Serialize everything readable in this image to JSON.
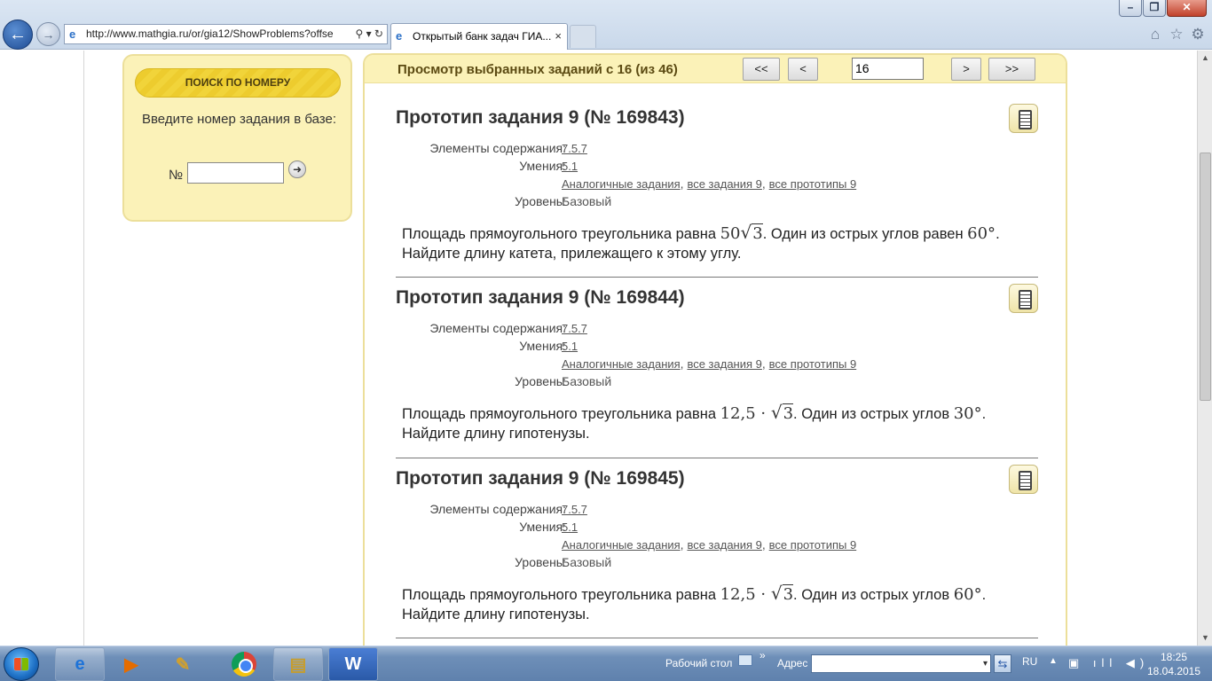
{
  "browser": {
    "address": "http://www.mathgia.ru/or/gia12/ShowProblems?offse",
    "tab_title": "Открытый банк задач ГИА...",
    "tab_close": "×",
    "back": "←",
    "forward": "→",
    "address_tools": "⚲ ▾ ↻",
    "window_min": "–",
    "window_max": "❐",
    "window_close": "✕"
  },
  "sidebar": {
    "search_title": "ПОИСК ПО НОМЕРУ",
    "prompt": "Введите номер задания в базе:",
    "num_label": "№",
    "num_value": "",
    "go_icon": "➜"
  },
  "viewer": {
    "title": "Просмотр выбранных заданий с 16 (из 46)",
    "first": "<<",
    "prev": "<",
    "page": "16",
    "next": ">",
    "last": ">>"
  },
  "problems": [
    {
      "title": "Прототип задания 9 (№ 169843)",
      "elements_label": "Элементы содержания:",
      "elements_value": "7.5.7",
      "skills_label": "Умения:",
      "skills_value": "5.1",
      "links": [
        "Аналогичные задания",
        "все задания 9",
        "все прототипы 9"
      ],
      "level_label": "Уровень:",
      "level_value": "Базовый",
      "text_before": "Площадь прямоугольного треугольника равна ",
      "math1": "50",
      "math1_sqrt": "3",
      "text_mid": ". Один из острых углов равен ",
      "math2": "60°",
      "text_after": ". Найдите длину катета, прилежащего к этому углу."
    },
    {
      "title": "Прототип задания 9 (№ 169844)",
      "elements_label": "Элементы содержания:",
      "elements_value": "7.5.7",
      "skills_label": "Умения:",
      "skills_value": "5.1",
      "links": [
        "Аналогичные задания",
        "все задания 9",
        "все прототипы 9"
      ],
      "level_label": "Уровень:",
      "level_value": "Базовый",
      "text_before": "Площадь прямоугольного треугольника равна ",
      "math1": "12,5 · ",
      "math1_sqrt": "3",
      "text_mid": ". Один из острых углов ",
      "math2": "30°",
      "text_after": ". Найдите длину гипотенузы."
    },
    {
      "title": "Прототип задания 9 (№ 169845)",
      "elements_label": "Элементы содержания:",
      "elements_value": "7.5.7",
      "skills_label": "Умения:",
      "skills_value": "5.1",
      "links": [
        "Аналогичные задания",
        "все задания 9",
        "все прототипы 9"
      ],
      "level_label": "Уровень:",
      "level_value": "Базовый",
      "text_before": "Площадь прямоугольного треугольника равна ",
      "math1": "12,5 · ",
      "math1_sqrt": "3",
      "text_mid": ". Один из острых углов ",
      "math2": "60°",
      "text_after": ". Найдите длину гипотенузы."
    }
  ],
  "taskbar": {
    "ie": "e",
    "media": "▶",
    "paint": "✎",
    "explorer": "▤",
    "word": "W",
    "desktop_label": "Рабочий стол",
    "chevron": "»",
    "address_label": "Адрес",
    "address_value": "",
    "address_drop": "▾",
    "go": "⇆",
    "lang": "RU",
    "tray_up": "▲",
    "tray_icons": "▣ ıll ◀)",
    "time": "18:25",
    "date": "18.04.2015"
  },
  "scroll": {
    "up": "▲",
    "down": "▼"
  },
  "icons": {
    "home": "⌂",
    "star": "☆",
    "gear": "⚙",
    "ie": "e"
  }
}
